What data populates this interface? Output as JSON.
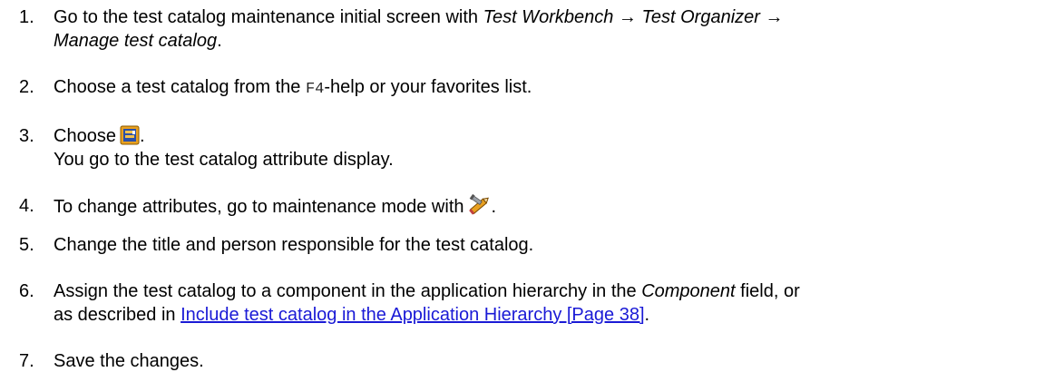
{
  "steps": [
    {
      "number": "1.",
      "text_a": "Go to the test catalog maintenance initial screen with ",
      "path_1": "Test Workbench",
      "arrow_1": " → ",
      "path_2": "Test Organizer",
      "arrow_2": " →",
      "path_3": "Manage test catalog",
      "text_b": "."
    },
    {
      "number": "2.",
      "text_a": "Choose a test catalog from the ",
      "code": "F4",
      "text_b": "-help or your favorites list."
    },
    {
      "number": "3.",
      "text_a": "Choose",
      "icon": "display-attributes-icon",
      "text_b": ".",
      "line_2": "You go to the test catalog attribute display."
    },
    {
      "number": "4.",
      "text_a": "To change attributes, go to maintenance mode with",
      "icon": "display-change-icon",
      "text_b": "."
    },
    {
      "number": "5.",
      "text_a": "Change the title and person responsible for the test catalog."
    },
    {
      "number": "6.",
      "text_a": "Assign the test catalog to a component in the application hierarchy in the ",
      "field": "Component",
      "text_b": " field, or",
      "text_c": "as described in ",
      "link": "Include test catalog in the Application Hierarchy [Page 38]",
      "text_d": "."
    },
    {
      "number": "7.",
      "text_a": "Save the changes."
    }
  ],
  "colors": {
    "link": "#1a1ad6",
    "icon_orange": "#e8a020",
    "icon_blue": "#2a4fa8"
  }
}
